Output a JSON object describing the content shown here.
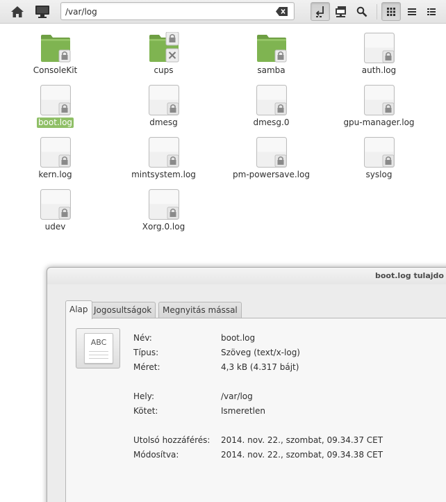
{
  "toolbar": {
    "home_icon": "home-icon",
    "computer_icon": "computer-icon",
    "location_value": "/var/log",
    "clear_icon": "clear-text-icon",
    "path_toggle_icon": "path-toggle-icon",
    "network_icon": "network-icon",
    "search_icon": "search-icon",
    "icon_view_icon": "icon-view-icon",
    "list_view_icon": "list-view-icon",
    "compact_view_icon": "compact-view-icon"
  },
  "files": [
    {
      "name": "ConsoleKit",
      "type": "folder"
    },
    {
      "name": "cups",
      "type": "folder"
    },
    {
      "name": "samba",
      "type": "folder"
    },
    {
      "name": "auth.log",
      "type": "file"
    },
    {
      "name": "boot.log",
      "type": "file"
    },
    {
      "name": "dmesg",
      "type": "file"
    },
    {
      "name": "dmesg.0",
      "type": "file"
    },
    {
      "name": "gpu-manager.log",
      "type": "file"
    },
    {
      "name": "kern.log",
      "type": "file"
    },
    {
      "name": "mintsystem.log",
      "type": "file"
    },
    {
      "name": "pm-powersave.log",
      "type": "file"
    },
    {
      "name": "syslog",
      "type": "file"
    },
    {
      "name": "udev",
      "type": "file"
    },
    {
      "name": "Xorg.0.log",
      "type": "file"
    }
  ],
  "dialog": {
    "title": "boot.log tulajdo",
    "tabs": [
      "Alap",
      "Jogosultságok",
      "Megnyitás mással"
    ],
    "icon_text": "ABC",
    "name_label": "Név:",
    "name_value": "boot.log",
    "type_label": "Típus:",
    "type_value": "Szöveg (text/x-log)",
    "size_label": "Méret:",
    "size_value": "4,3 kB (4.317 bájt)",
    "location_label": "Hely:",
    "location_value": "/var/log",
    "volume_label": "Kötet:",
    "volume_value": "Ismeretlen",
    "accessed_label": "Utolsó hozzáférés:",
    "accessed_value": "2014. nov. 22., szombat, 09.34.37 CET",
    "modified_label": "Módosítva:",
    "modified_value": "2014. nov. 22., szombat, 09.34.38 CET"
  },
  "colors": {
    "folder_green": "#7fb451",
    "selection_green": "#8fbf66"
  }
}
